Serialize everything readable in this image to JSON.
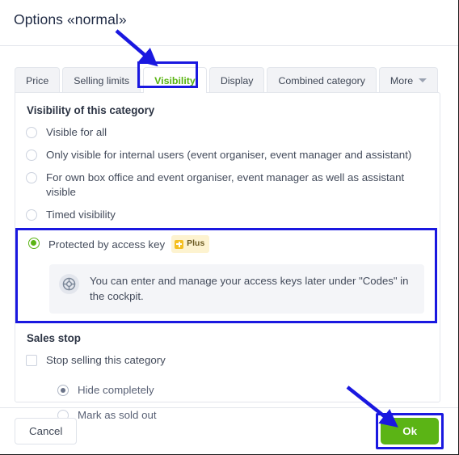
{
  "dialog": {
    "title": "Options «normal»"
  },
  "tabs": [
    {
      "label": "Price",
      "active": false
    },
    {
      "label": "Selling limits",
      "active": false
    },
    {
      "label": "Visibility",
      "active": true
    },
    {
      "label": "Display",
      "active": false
    },
    {
      "label": "Combined category",
      "active": false
    },
    {
      "label": "More",
      "active": false,
      "icon": "chevron-down-icon"
    }
  ],
  "visibility": {
    "section_title": "Visibility of this category",
    "options": [
      {
        "label": "Visible for all",
        "selected": false
      },
      {
        "label": "Only visible for internal users (event organiser, event manager and assistant)",
        "selected": false
      },
      {
        "label": "For own box office and event organiser, event manager as well as assistant visible",
        "selected": false
      },
      {
        "label": "Timed visibility",
        "selected": false
      }
    ],
    "protected_option": {
      "label": "Protected by access key",
      "selected": true,
      "badge": "Plus",
      "badge_icon": "plus-square-icon",
      "info_icon": "lifebuoy-icon",
      "info_text": "You can enter and manage your access keys later under \"Codes\" in the cockpit."
    }
  },
  "sales_stop": {
    "section_title": "Sales stop",
    "checkbox_label": "Stop selling this category",
    "checkbox_checked": false,
    "options": [
      {
        "label": "Hide completely",
        "selected": true
      },
      {
        "label": "Mark as sold out",
        "selected": false
      }
    ]
  },
  "footer": {
    "cancel_label": "Cancel",
    "ok_label": "Ok"
  },
  "colors": {
    "accent_green": "#5bb415",
    "annotation_blue": "#1a18e0",
    "badge_yellow": "#f4bf21",
    "title_navy": "#1f2a44"
  }
}
